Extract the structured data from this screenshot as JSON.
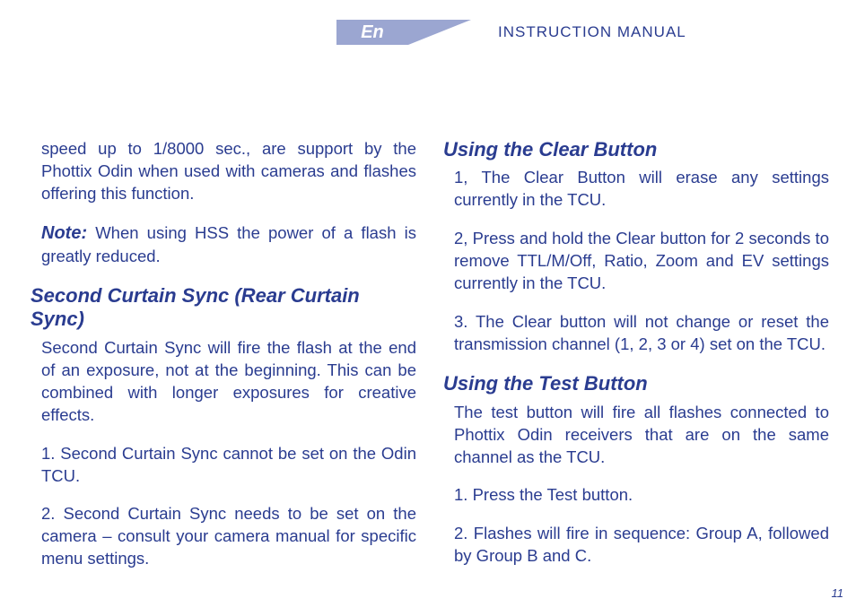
{
  "header": {
    "lang": "En",
    "title": "INSTRUCTION MANUAL"
  },
  "left": {
    "p1": "speed up to 1/8000 sec., are support by the Phottix Odin when used with cameras and flashes offering this function.",
    "note_label": "Note:",
    "note_body": " When using HSS the power of a flash is greatly reduced.",
    "h1": "Second Curtain Sync (Rear Curtain Sync)",
    "p2": "Second Curtain Sync will fire the flash at the end of an exposure, not at the beginning. This can be combined with longer exposures for creative effects.",
    "p3": "1. Second Curtain Sync cannot be set on the Odin TCU.",
    "p4": "2. Second Curtain Sync needs to be set on the camera – consult your camera manual for specific menu settings."
  },
  "right": {
    "h1": "Using the Clear Button",
    "p1": "1, The Clear Button will erase any settings currently in the TCU.",
    "p2": "2, Press and hold the Clear button for 2 seconds to remove TTL/M/Off, Ratio, Zoom and EV settings currently in the TCU.",
    "p3": "3. The Clear button will not change or reset the transmission channel (1, 2, 3 or 4) set on the TCU.",
    "h2": "Using the Test Button",
    "p4": "The test button will fire all flashes connected to Phottix Odin receivers that are on the same channel as the TCU.",
    "p5": "1. Press the Test button.",
    "p6": "2. Flashes will fire in sequence: Group A, followed by Group B and C."
  },
  "page_number": "11"
}
